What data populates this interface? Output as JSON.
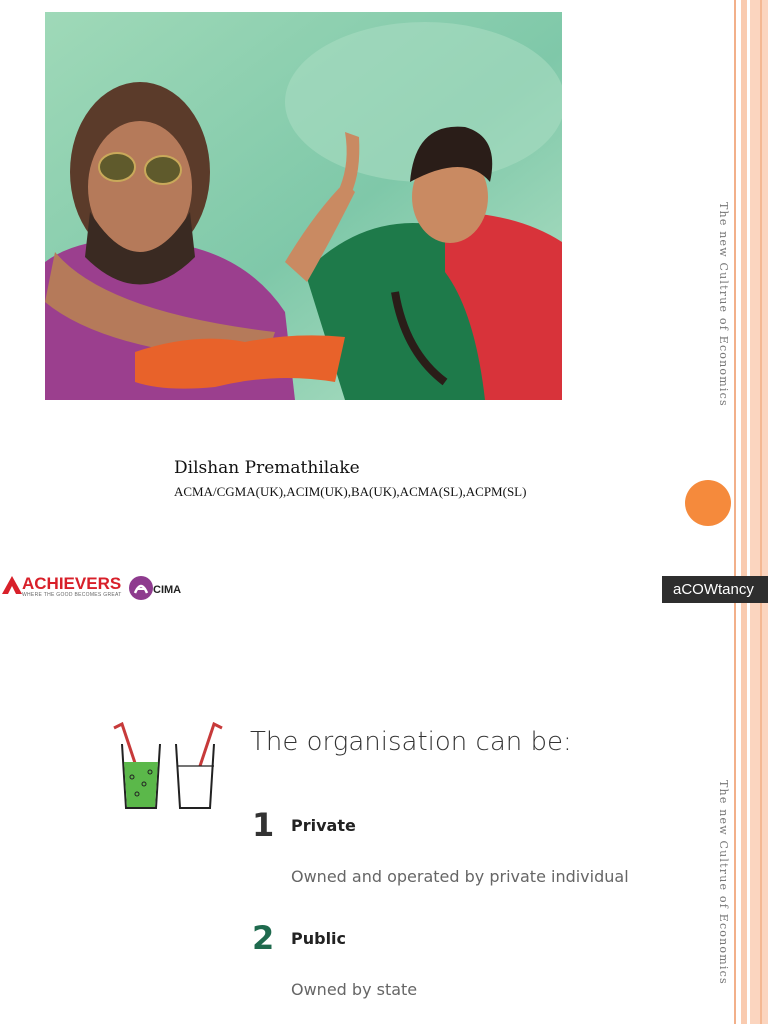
{
  "slide1": {
    "side_label": "The new Cultrue of Economics",
    "author_name": "Dilshan Premathilake",
    "credentials": "ACMA/CGMA(UK),ACIM(UK),BA(UK),ACMA(SL),ACPM(SL)",
    "logos": {
      "achievers": "ACHIEVERS",
      "achievers_tagline": "WHERE THE GOOD BECOMES GREAT",
      "cima": "CIMA",
      "acowtancy": "aCOWtancy"
    }
  },
  "slide2": {
    "side_label": "The new Cultrue of Economics",
    "heading": "The organisation can be:",
    "items": [
      {
        "number": "1",
        "title": "Private",
        "description": "Owned and operated by private individual"
      },
      {
        "number": "2",
        "title": "Public",
        "description": "Owned by state"
      }
    ]
  },
  "colors": {
    "accent_orange": "#f58a3c",
    "stripe_peach": "#fbd5bf",
    "achievers_red": "#d8202a",
    "acowtancy_bg": "#2e2e2e",
    "number_green": "#1f6a4e"
  }
}
